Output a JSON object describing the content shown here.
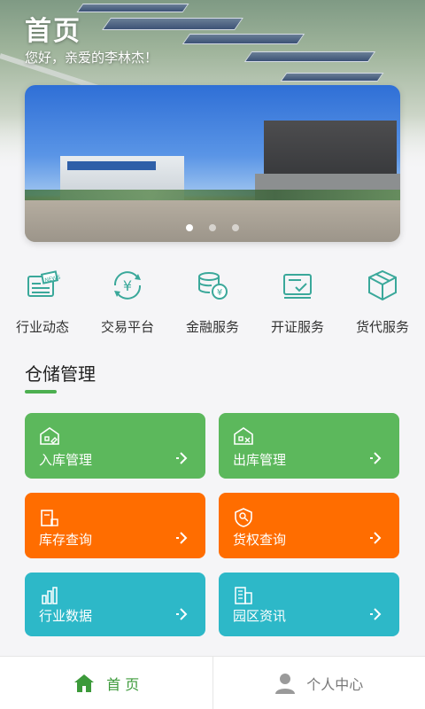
{
  "header": {
    "title": "首页",
    "greeting": "您好，亲爱的李林杰！"
  },
  "banner": {
    "slide_count": 3,
    "active_slide": 1
  },
  "services": [
    {
      "label": "行业动态",
      "icon": "newspaper-icon"
    },
    {
      "label": "交易平台",
      "icon": "yen-exchange-icon"
    },
    {
      "label": "金融服务",
      "icon": "coins-icon"
    },
    {
      "label": "开证服务",
      "icon": "certificate-icon"
    },
    {
      "label": "货代服务",
      "icon": "package-icon"
    }
  ],
  "section": {
    "title": "仓储管理"
  },
  "tiles": [
    {
      "label": "入库管理",
      "icon": "warehouse-in-icon",
      "color": "#5cb85c"
    },
    {
      "label": "出库管理",
      "icon": "warehouse-out-icon",
      "color": "#5cb85c"
    },
    {
      "label": "库存查询",
      "icon": "inventory-icon",
      "color": "#ff6d00"
    },
    {
      "label": "货权查询",
      "icon": "ownership-icon",
      "color": "#ff6d00"
    },
    {
      "label": "行业数据",
      "icon": "bar-chart-icon",
      "color": "#2db8c8"
    },
    {
      "label": "园区资讯",
      "icon": "building-icon",
      "color": "#2db8c8"
    }
  ],
  "nav": {
    "home_label": "首 页",
    "profile_label": "个人中心",
    "active": "home"
  },
  "colors": {
    "accent": "#4caf50",
    "service_icon": "#3aa89a"
  }
}
